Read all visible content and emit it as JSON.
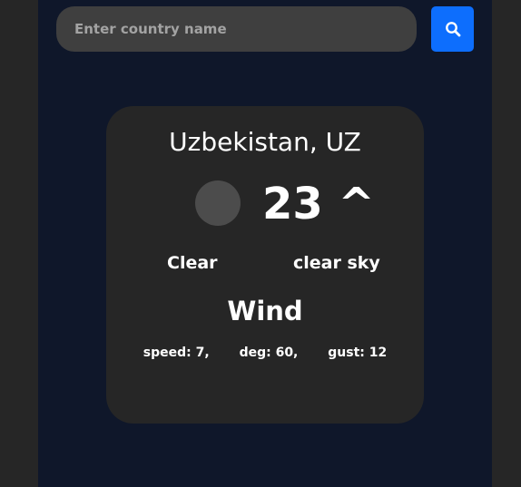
{
  "search": {
    "placeholder": "Enter country name",
    "value": "",
    "button_icon": "search-icon",
    "button_color": "#0d6efd"
  },
  "weather": {
    "location": "Uzbekistan, UZ",
    "icon": "weather-icon-placeholder",
    "temperature": "23 ^",
    "condition_main": "Clear",
    "condition_description": "clear sky"
  },
  "wind": {
    "title": "Wind",
    "speed": "speed: 7,",
    "deg": "deg: 60,",
    "gust": "gust: 12"
  },
  "colors": {
    "page_background": "#262626",
    "app_background": "#0f172a",
    "card_background": "#262626",
    "input_background": "#3f3f3f",
    "accent": "#0d6efd"
  }
}
